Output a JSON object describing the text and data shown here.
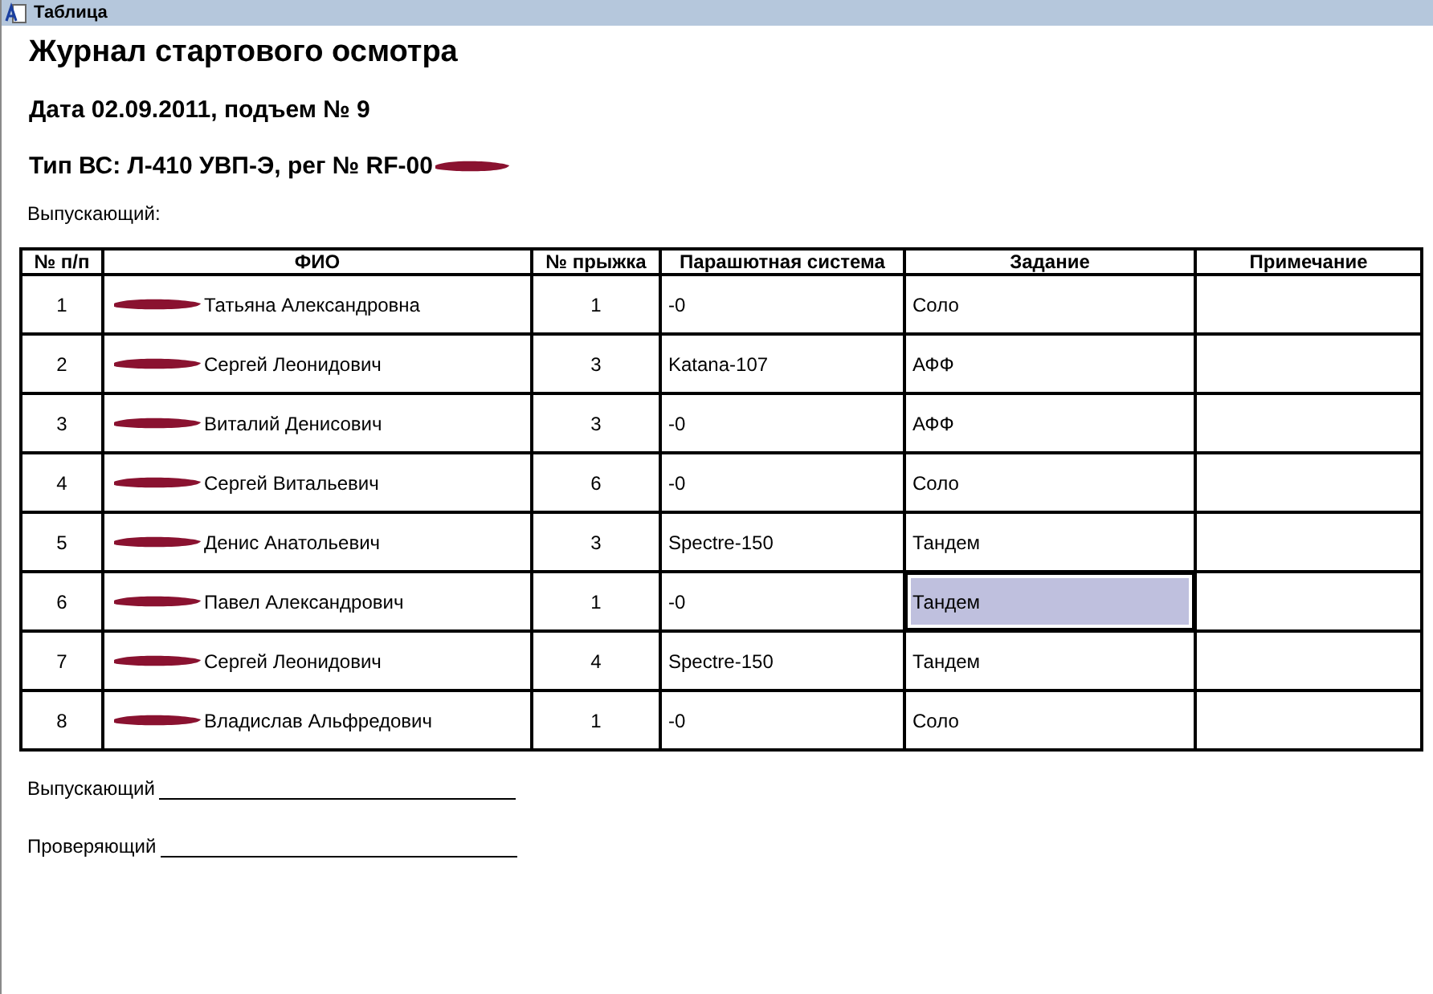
{
  "window": {
    "title": "Таблица"
  },
  "title": "Журнал стартового осмотра",
  "date_line": "Дата 02.09.2011, подъем № 9",
  "aircraft_line": "Тип ВС: Л-410 УВП-Э, рег № RF-00",
  "releaser_label": "Выпускающий:",
  "table": {
    "columns": [
      "№ п/п",
      "ФИО",
      "№ прыжка",
      "Парашютная система",
      "Задание",
      "Примечание"
    ],
    "rows": [
      {
        "number": "1",
        "name": "Татьяна Александровна",
        "jump": "1",
        "system": "-0",
        "task": "Соло",
        "task_selected": false
      },
      {
        "number": "2",
        "name": "Сергей Леонидович",
        "jump": "3",
        "system": "Katana-107",
        "task": "АФФ",
        "task_selected": false
      },
      {
        "number": "3",
        "name": "Виталий Денисович",
        "jump": "3",
        "system": "-0",
        "task": "АФФ",
        "task_selected": false
      },
      {
        "number": "4",
        "name": "Сергей  Витальевич",
        "jump": "6",
        "system": "-0",
        "task": "Соло",
        "task_selected": false
      },
      {
        "number": "5",
        "name": "Денис Анатольевич",
        "jump": "3",
        "system": "Spectre-150",
        "task": "Тандем",
        "task_selected": false
      },
      {
        "number": "6",
        "name": "Павел Александрович",
        "jump": "1",
        "system": "-0",
        "task": "Тандем",
        "task_selected": true
      },
      {
        "number": "7",
        "name": "Сергей Леонидович",
        "jump": "4",
        "system": "Spectre-150",
        "task": "Тандем",
        "task_selected": false
      },
      {
        "number": "8",
        "name": "Владислав Альфредович",
        "jump": "1",
        "system": "-0",
        "task": "Соло",
        "task_selected": false
      }
    ]
  },
  "signatures": [
    "Выпускающий",
    "Проверяющий"
  ]
}
